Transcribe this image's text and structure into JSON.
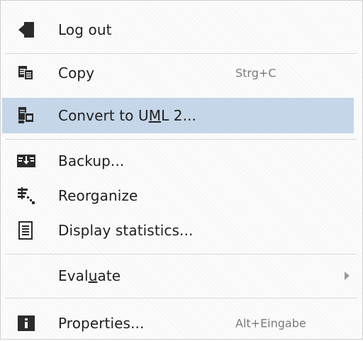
{
  "menu": {
    "logout": {
      "label": "Log out"
    },
    "copy": {
      "label": "Copy",
      "shortcut": "Strg+C"
    },
    "convert": {
      "label_before": "Convert to U",
      "mnemonic": "M",
      "label_after": "L 2..."
    },
    "backup": {
      "label": "Backup..."
    },
    "reorganize": {
      "label": "Reorganize"
    },
    "statistics": {
      "label": "Display statistics..."
    },
    "evaluate": {
      "label_before": "Eval",
      "mnemonic": "u",
      "label_after": "ate"
    },
    "properties": {
      "label": "Properties...",
      "shortcut": "Alt+Eingabe"
    }
  },
  "colors": {
    "highlight": "#c5d6e8",
    "icon": "#2b2b2b",
    "separator": "#d8d8d8"
  },
  "icons": [
    "logout-icon",
    "copy-icon",
    "convert-icon",
    "backup-icon",
    "reorganize-icon",
    "statistics-icon",
    "properties-icon"
  ]
}
